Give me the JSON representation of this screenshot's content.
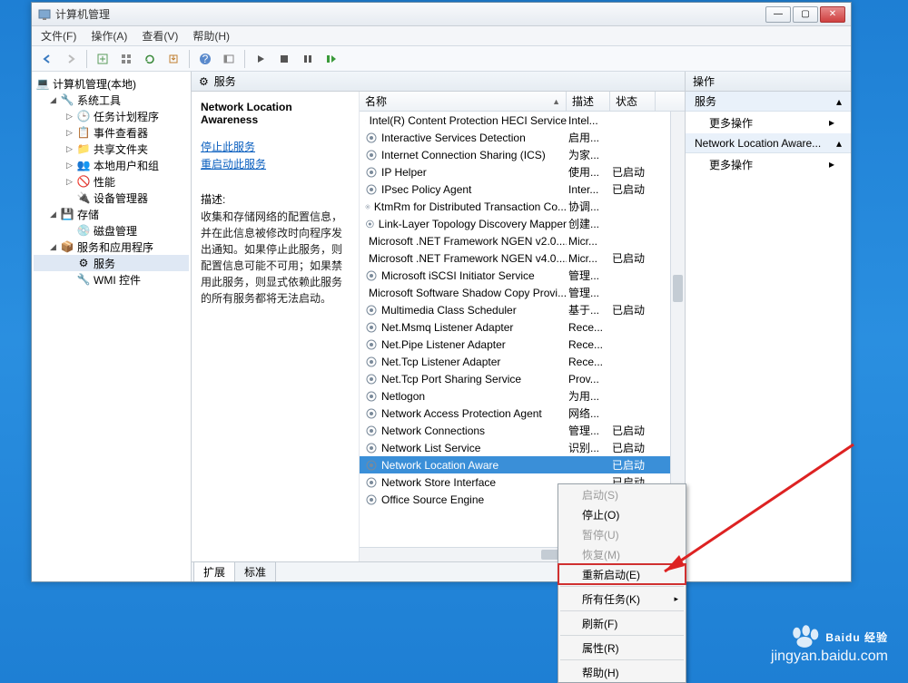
{
  "window": {
    "title": "计算机管理"
  },
  "menus": {
    "file": "文件(F)",
    "action": "操作(A)",
    "view": "查看(V)",
    "help": "帮助(H)"
  },
  "tree": {
    "root": "计算机管理(本地)",
    "sys_tools": "系统工具",
    "task_sched": "任务计划程序",
    "event_viewer": "事件查看器",
    "shared": "共享文件夹",
    "local_users": "本地用户和组",
    "perf": "性能",
    "devmgr": "设备管理器",
    "storage": "存储",
    "diskmgr": "磁盘管理",
    "services_apps": "服务和应用程序",
    "services": "服务",
    "wmi": "WMI 控件"
  },
  "mid_header": "服务",
  "desc": {
    "title": "Network Location Awareness",
    "stop": "停止此服务",
    "restart": "重启动此服务",
    "label": "描述:",
    "text": "收集和存储网络的配置信息，并在此信息被修改时向程序发出通知。如果停止此服务，则配置信息可能不可用；如果禁用此服务，则显式依赖此服务的所有服务都将无法启动。"
  },
  "cols": {
    "name": "名称",
    "desc": "描述",
    "status": "状态"
  },
  "services": [
    {
      "n": "Intel(R) Content Protection HECI Service",
      "d": "Intel...",
      "s": ""
    },
    {
      "n": "Interactive Services Detection",
      "d": "启用...",
      "s": ""
    },
    {
      "n": "Internet Connection Sharing (ICS)",
      "d": "为家...",
      "s": ""
    },
    {
      "n": "IP Helper",
      "d": "使用...",
      "s": "已启动"
    },
    {
      "n": "IPsec Policy Agent",
      "d": "Inter...",
      "s": "已启动"
    },
    {
      "n": "KtmRm for Distributed Transaction Co...",
      "d": "协调...",
      "s": ""
    },
    {
      "n": "Link-Layer Topology Discovery Mapper",
      "d": "创建...",
      "s": ""
    },
    {
      "n": "Microsoft .NET Framework NGEN v2.0....",
      "d": "Micr...",
      "s": ""
    },
    {
      "n": "Microsoft .NET Framework NGEN v4.0....",
      "d": "Micr...",
      "s": "已启动"
    },
    {
      "n": "Microsoft iSCSI Initiator Service",
      "d": "管理...",
      "s": ""
    },
    {
      "n": "Microsoft Software Shadow Copy Provi...",
      "d": "管理...",
      "s": ""
    },
    {
      "n": "Multimedia Class Scheduler",
      "d": "基于...",
      "s": "已启动"
    },
    {
      "n": "Net.Msmq Listener Adapter",
      "d": "Rece...",
      "s": ""
    },
    {
      "n": "Net.Pipe Listener Adapter",
      "d": "Rece...",
      "s": ""
    },
    {
      "n": "Net.Tcp Listener Adapter",
      "d": "Rece...",
      "s": ""
    },
    {
      "n": "Net.Tcp Port Sharing Service",
      "d": "Prov...",
      "s": ""
    },
    {
      "n": "Netlogon",
      "d": "为用...",
      "s": ""
    },
    {
      "n": "Network Access Protection Agent",
      "d": "网络...",
      "s": ""
    },
    {
      "n": "Network Connections",
      "d": "管理...",
      "s": "已启动"
    },
    {
      "n": "Network List Service",
      "d": "识别...",
      "s": "已启动"
    },
    {
      "n": "Network Location Aware",
      "d": "",
      "s": "已启动",
      "sel": true
    },
    {
      "n": "Network Store Interface",
      "d": "",
      "s": "已启动"
    },
    {
      "n": "Office Source Engine",
      "d": "",
      "s": ""
    }
  ],
  "tabs": {
    "ext": "扩展",
    "std": "标准"
  },
  "actions": {
    "header": "操作",
    "sec1": "服务",
    "more1": "更多操作",
    "sec2": "Network Location Aware...",
    "more2": "更多操作"
  },
  "context": {
    "start": "启动(S)",
    "stop": "停止(O)",
    "pause": "暂停(U)",
    "resume": "恢复(M)",
    "restart": "重新启动(E)",
    "all_tasks": "所有任务(K)",
    "refresh": "刷新(F)",
    "props": "属性(R)",
    "help": "帮助(H)"
  },
  "watermark": {
    "brand": "Baidu 经验",
    "url": "jingyan.baidu.com"
  }
}
